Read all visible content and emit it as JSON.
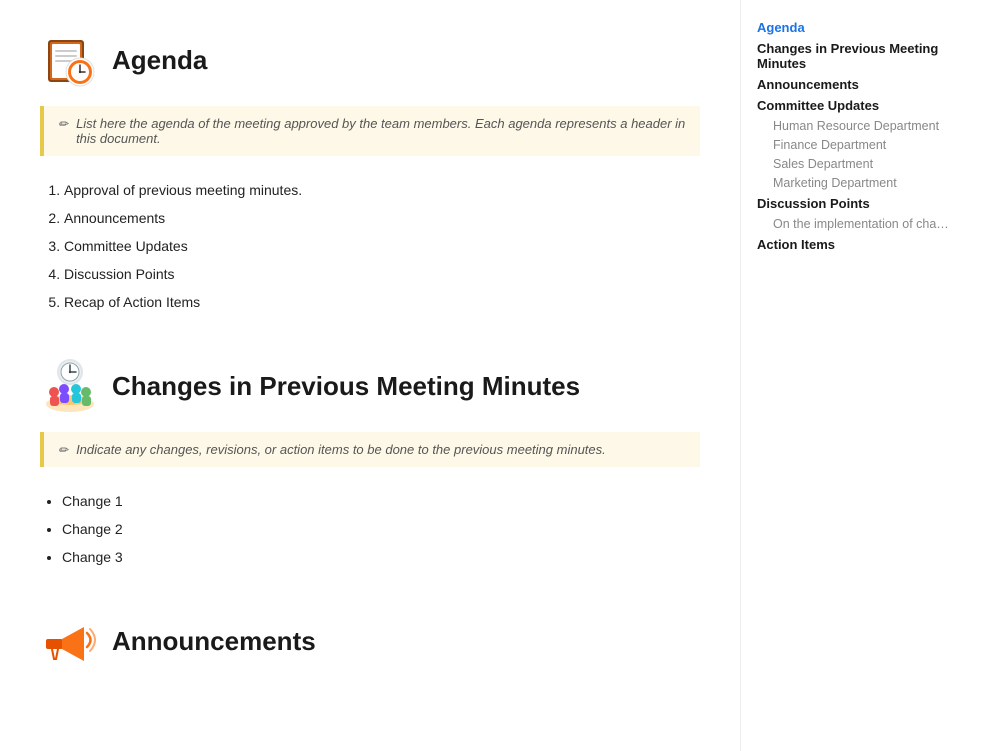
{
  "sections": [
    {
      "id": "agenda",
      "title": "Agenda",
      "icon_type": "calendar-clock",
      "callout": "List here the agenda of the meeting approved by the team members. Each agenda represents a header in this document.",
      "list_type": "ordered",
      "items": [
        "Approval of previous meeting minutes.",
        "Announcements",
        "Committee Updates",
        "Discussion Points",
        "Recap of Action Items"
      ]
    },
    {
      "id": "changes",
      "title": "Changes in Previous Meeting Minutes",
      "icon_type": "clock-people",
      "callout": "Indicate any changes, revisions, or action items to be done to the previous meeting minutes.",
      "list_type": "unordered",
      "items": [
        "Change 1",
        "Change 2",
        "Change 3"
      ]
    },
    {
      "id": "announcements",
      "title": "Announcements",
      "icon_type": "megaphone",
      "callout": null,
      "list_type": null,
      "items": []
    }
  ],
  "sidebar": {
    "nav_items": [
      {
        "label": "Agenda",
        "level": "active",
        "id": "agenda"
      },
      {
        "label": "Changes in Previous Meeting Minutes",
        "level": "top",
        "id": "changes"
      },
      {
        "label": "Announcements",
        "level": "top",
        "id": "announcements"
      },
      {
        "label": "Committee Updates",
        "level": "top",
        "id": "committee"
      },
      {
        "label": "Human Resource Department",
        "level": "sub",
        "id": "hr"
      },
      {
        "label": "Finance Department",
        "level": "sub",
        "id": "finance"
      },
      {
        "label": "Sales Department",
        "level": "sub",
        "id": "sales"
      },
      {
        "label": "Marketing Department",
        "level": "sub",
        "id": "marketing"
      },
      {
        "label": "Discussion Points",
        "level": "top",
        "id": "discussion"
      },
      {
        "label": "On the implementation of changes in...",
        "level": "sub",
        "id": "discussion-sub"
      },
      {
        "label": "Action Items",
        "level": "top",
        "id": "action"
      }
    ]
  },
  "callout_pencil": "✏",
  "colors": {
    "accent_blue": "#1a73e8",
    "sidebar_active": "#1a73e8",
    "callout_bg": "#fdf8e7",
    "callout_border": "#e6c84a"
  }
}
